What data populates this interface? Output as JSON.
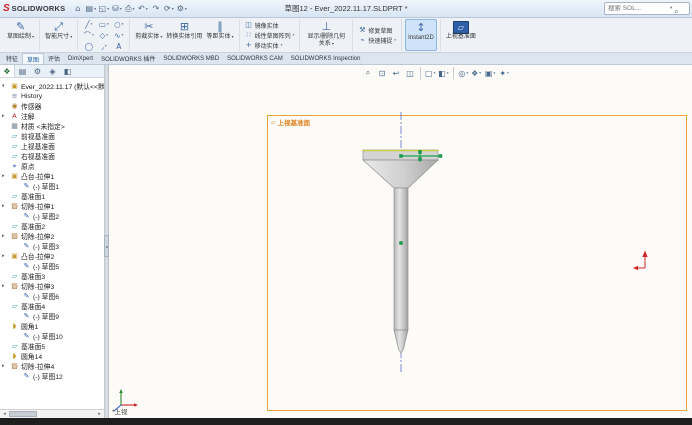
{
  "titlebar": {
    "brand": "SOLIDWORKS",
    "title": "草图12 - Ever_2022.11.17.SLDPRT *",
    "search_placeholder": "搜索 SOL...",
    "icons": [
      {
        "name": "home-icon",
        "glyph": "⌂",
        "dd": false
      },
      {
        "name": "new-document-icon",
        "glyph": "▤",
        "dd": true
      },
      {
        "name": "open-icon",
        "glyph": "◱",
        "dd": true
      },
      {
        "name": "save-icon",
        "glyph": "⛁",
        "dd": true
      },
      {
        "name": "print-icon",
        "glyph": "⎙",
        "dd": true
      },
      {
        "name": "undo-icon",
        "glyph": "↶",
        "dd": true
      },
      {
        "name": "redo-icon",
        "glyph": "↷",
        "dd": false
      },
      {
        "name": "rebuild-icon",
        "glyph": "⟳",
        "dd": true
      },
      {
        "name": "options-icon",
        "glyph": "⚙",
        "dd": true
      }
    ]
  },
  "ribbon": {
    "sketch": {
      "label": "草图绘制",
      "glyph": "✎"
    },
    "smart_dimension": {
      "label": "智能尺寸",
      "glyph": "⤢"
    },
    "trim": {
      "label": "剪裁实体",
      "glyph": "✂"
    },
    "convert": {
      "label": "转换实体引用",
      "glyph": "⊞"
    },
    "offset": {
      "label": "等距实体",
      "glyph": "∥"
    },
    "relations": {
      "label": "显示/删除几何关系",
      "glyph": "⊥"
    },
    "instant2d": {
      "label": "Instant2D",
      "glyph": "↕"
    },
    "plane_tool": {
      "label": "上视基准面",
      "glyph": "▱"
    },
    "small_left": [
      {
        "name": "mirror-entities-button",
        "label": "镜像实体",
        "glyph": "◫",
        "dd": false
      },
      {
        "name": "linear-sketch-pattern-button",
        "label": "线性草图阵列",
        "glyph": "∷",
        "dd": true
      },
      {
        "name": "move-entities-button",
        "label": "移动实体",
        "glyph": "+",
        "dd": true
      }
    ],
    "small_right": [
      {
        "name": "repair-sketch-button",
        "label": "修复草图",
        "glyph": "⚒",
        "dd": false
      },
      {
        "name": "quick-snaps-button",
        "label": "快速捕捉",
        "glyph": "⌁",
        "dd": true
      }
    ],
    "sketch_tools": [
      {
        "name": "line-tool",
        "glyph": "╱",
        "dd": true
      },
      {
        "name": "rectangle-tool",
        "glyph": "▭",
        "dd": true
      },
      {
        "name": "circle-tool",
        "glyph": "○",
        "dd": true
      },
      {
        "name": "arc-tool",
        "glyph": "⌒",
        "dd": true
      },
      {
        "name": "polygon-tool",
        "glyph": "◇",
        "dd": true
      },
      {
        "name": "spline-tool",
        "glyph": "∿",
        "dd": true
      },
      {
        "name": "ellipse-tool",
        "glyph": "◯",
        "dd": false
      },
      {
        "name": "sketch-fillet-tool",
        "glyph": "◞",
        "dd": true
      },
      {
        "name": "text-tool",
        "glyph": "A",
        "dd": false
      }
    ]
  },
  "tabs": [
    {
      "label": "特征",
      "active": false
    },
    {
      "label": "草图",
      "active": true
    },
    {
      "label": "评估",
      "active": false
    },
    {
      "label": "DimXpert",
      "active": false
    },
    {
      "label": "SOLIDWORKS 插件",
      "active": false
    },
    {
      "label": "SOLIDWORKS MBD",
      "active": false
    },
    {
      "label": "SOLIDWORKS CAM",
      "active": false
    },
    {
      "label": "SOLIDWORKS Inspection",
      "active": false
    }
  ],
  "manager_tabs": [
    {
      "name": "featuremanager-tab",
      "glyph": "❖",
      "active": true
    },
    {
      "name": "propertymanager-tab",
      "glyph": "▤",
      "active": false
    },
    {
      "name": "configurationmanager-tab",
      "glyph": "⚙",
      "active": false
    },
    {
      "name": "dimxpertmanager-tab",
      "glyph": "◈",
      "active": false
    },
    {
      "name": "displaymanager-tab",
      "glyph": "◧",
      "active": false
    }
  ],
  "tree": {
    "root": "Ever_2022.11.17 (默认<<默认>_显示状态",
    "items": [
      {
        "label": "History",
        "icon": "history"
      },
      {
        "label": "传感器",
        "icon": "sensors"
      },
      {
        "label": "注解",
        "icon": "annotations",
        "expand": true
      },
      {
        "label": "材质 <未指定>",
        "icon": "material"
      },
      {
        "label": "前视基准面",
        "icon": "plane"
      },
      {
        "label": "上视基准面",
        "icon": "plane"
      },
      {
        "label": "右视基准面",
        "icon": "plane"
      },
      {
        "label": "原点",
        "icon": "origin"
      },
      {
        "label": "凸台-拉伸1",
        "icon": "boss",
        "expand": true
      },
      {
        "label": "(-) 草图1",
        "icon": "sketch",
        "indent": 1
      },
      {
        "label": "基准面1",
        "icon": "plane"
      },
      {
        "label": "切除-拉伸1",
        "icon": "cut",
        "expand": true
      },
      {
        "label": "(-) 草图2",
        "icon": "sketch",
        "indent": 1
      },
      {
        "label": "基准面2",
        "icon": "plane"
      },
      {
        "label": "切除-拉伸2",
        "icon": "cut",
        "expand": true
      },
      {
        "label": "(-) 草图3",
        "icon": "sketch",
        "indent": 1
      },
      {
        "label": "凸台-拉伸2",
        "icon": "boss",
        "expand": true
      },
      {
        "label": "(-) 草图5",
        "icon": "sketch",
        "indent": 1
      },
      {
        "label": "基准面3",
        "icon": "plane"
      },
      {
        "label": "切除-拉伸3",
        "icon": "cut",
        "expand": true
      },
      {
        "label": "(-) 草图6",
        "icon": "sketch",
        "indent": 1
      },
      {
        "label": "基准面4",
        "icon": "plane"
      },
      {
        "label": "(-) 草图9",
        "icon": "sketch",
        "indent": 1
      },
      {
        "label": "圆角1",
        "icon": "fillet"
      },
      {
        "label": "(-) 草图10",
        "icon": "sketch",
        "indent": 1
      },
      {
        "label": "基准面5",
        "icon": "plane"
      },
      {
        "label": "圆角14",
        "icon": "fillet"
      },
      {
        "label": "切除-拉伸4",
        "icon": "cut",
        "expand": true
      },
      {
        "label": "(-) 草图12",
        "icon": "sketch",
        "indent": 1
      }
    ]
  },
  "viewport": {
    "plane_label": "上视基准面",
    "view_label": "*上视",
    "headsup": [
      {
        "name": "zoom-fit",
        "glyph": "⌕",
        "dd": false,
        "sep": false
      },
      {
        "name": "zoom-area",
        "glyph": "⊡",
        "dd": false,
        "sep": false
      },
      {
        "name": "previous-view",
        "glyph": "↩",
        "dd": false,
        "sep": false
      },
      {
        "name": "section-view",
        "glyph": "◫",
        "dd": false,
        "sep": false
      },
      {
        "name": "view-orientation",
        "glyph": "▢",
        "dd": true,
        "sep": true
      },
      {
        "name": "display-style",
        "glyph": "◧",
        "dd": true,
        "sep": false
      },
      {
        "name": "hide-show-items",
        "glyph": "◎",
        "dd": true,
        "sep": true
      },
      {
        "name": "edit-appearance",
        "glyph": "❖",
        "dd": true,
        "sep": false
      },
      {
        "name": "apply-scene",
        "glyph": "▣",
        "dd": true,
        "sep": false
      },
      {
        "name": "view-settings",
        "glyph": "✦",
        "dd": true,
        "sep": false
      }
    ]
  },
  "colors": {
    "plane_border": "#e8a23a",
    "selection_green": "#18a24d",
    "centerline_blue": "#5b6ecf",
    "accent_blue": "#2f5fa8"
  }
}
